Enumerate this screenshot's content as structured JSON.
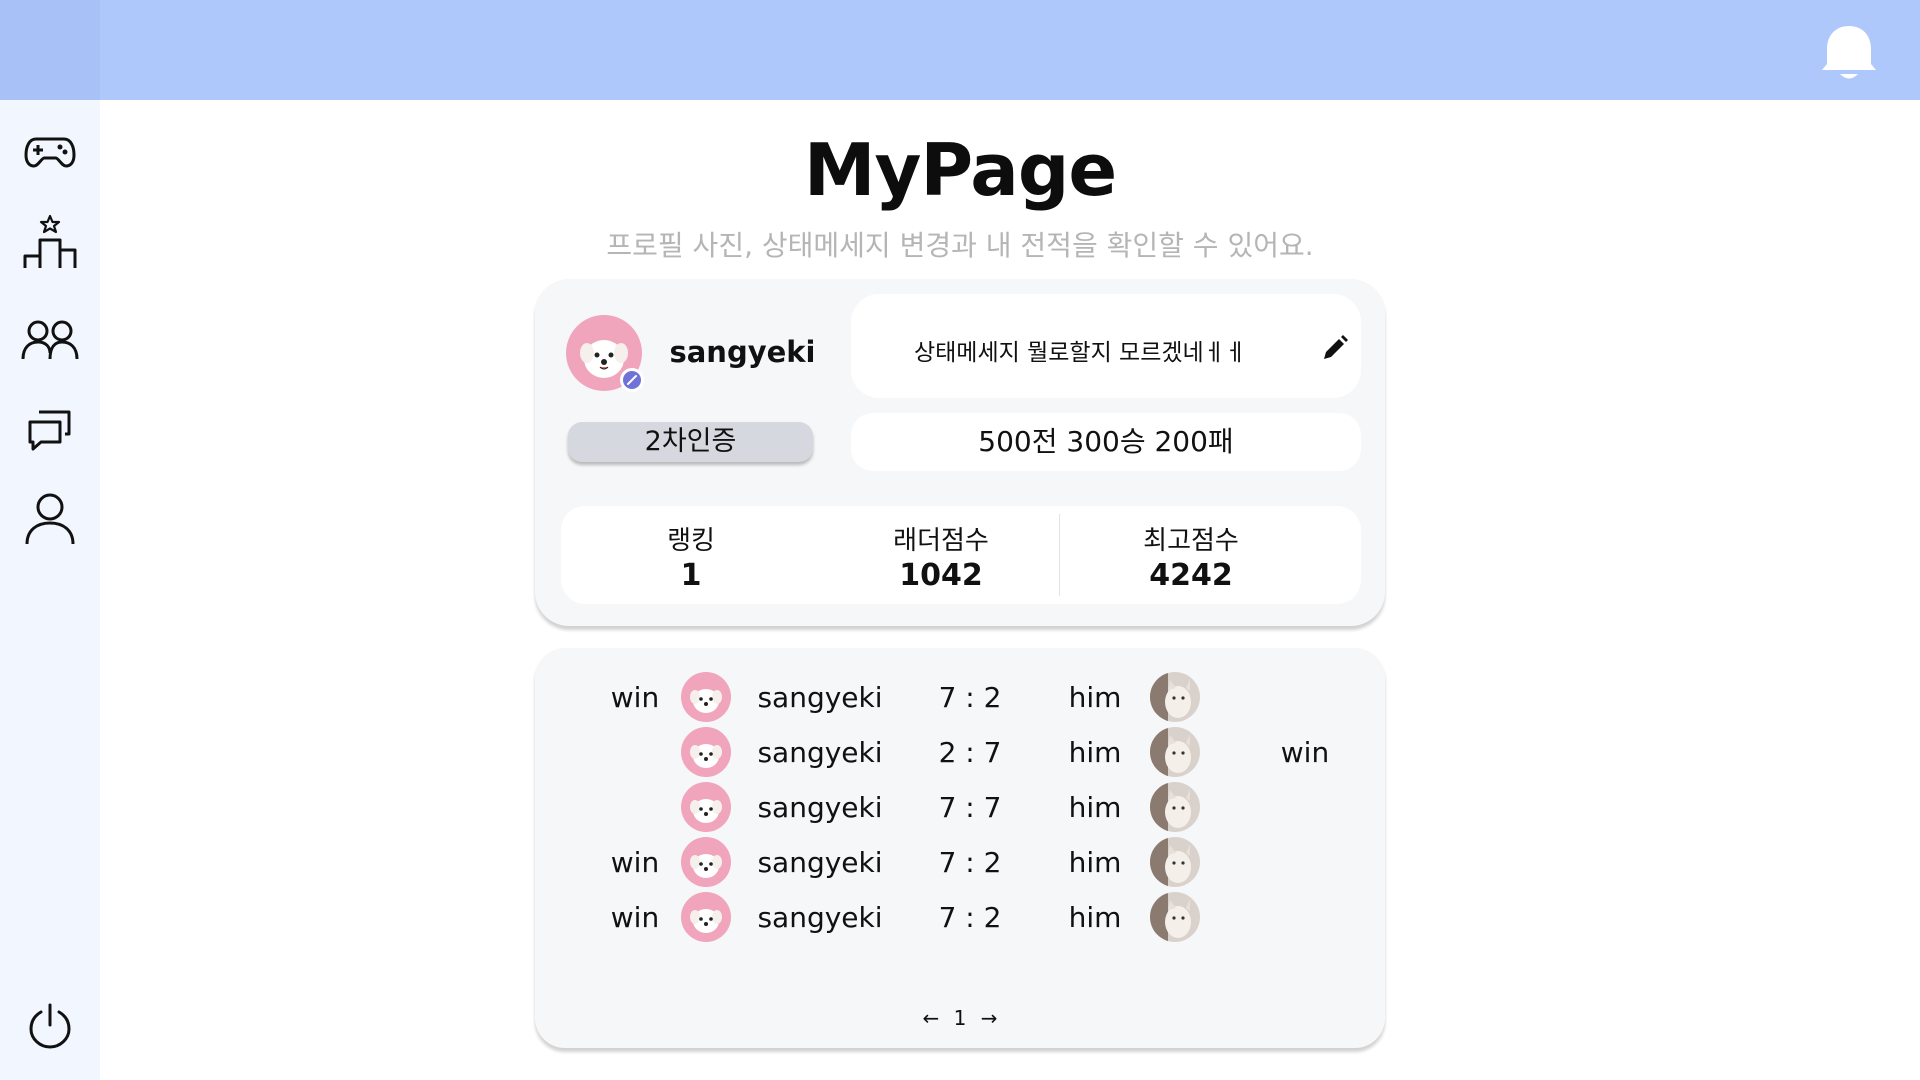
{
  "header": {
    "bell_icon": "bell-icon"
  },
  "sidebar": {
    "items": [
      {
        "icon": "gamepad-icon"
      },
      {
        "icon": "ranking-podium-icon"
      },
      {
        "icon": "friends-icon"
      },
      {
        "icon": "chat-icon"
      },
      {
        "icon": "user-icon"
      }
    ],
    "logout_icon": "power-icon"
  },
  "page": {
    "title": "MyPage",
    "subtitle": "프로필 사진, 상태메세지 변경과 내 전적을 확인할 수 있어요."
  },
  "profile": {
    "username": "sangyeki",
    "status_message": "상태메세지 뭘로할지 모르겠네ㅔㅔ",
    "twofa_label": "2차인증",
    "record": "500전 300승 200패",
    "stats": [
      {
        "label": "랭킹",
        "value": "1"
      },
      {
        "label": "래더점수",
        "value": "1042"
      },
      {
        "label": "최고점수",
        "value": "4242"
      }
    ]
  },
  "history": {
    "rows": [
      {
        "left_result": "win",
        "player": "sangyeki",
        "score": "7 : 2",
        "opponent": "him",
        "right_result": ""
      },
      {
        "left_result": "",
        "player": "sangyeki",
        "score": "2 : 7",
        "opponent": "him",
        "right_result": "win"
      },
      {
        "left_result": "",
        "player": "sangyeki",
        "score": "7 : 7",
        "opponent": "him",
        "right_result": ""
      },
      {
        "left_result": "win",
        "player": "sangyeki",
        "score": "7 : 2",
        "opponent": "him",
        "right_result": ""
      },
      {
        "left_result": "win",
        "player": "sangyeki",
        "score": "7 : 2",
        "opponent": "him",
        "right_result": ""
      }
    ],
    "pagination": {
      "prev": "←",
      "page": "1",
      "next": "→"
    }
  },
  "colors": {
    "topbar": "#afc8fc",
    "sidebar": "#f2f6ff",
    "card": "#f6f7f9",
    "badge": "#6f72d6",
    "avatar_pink": "#f0a5bd"
  }
}
